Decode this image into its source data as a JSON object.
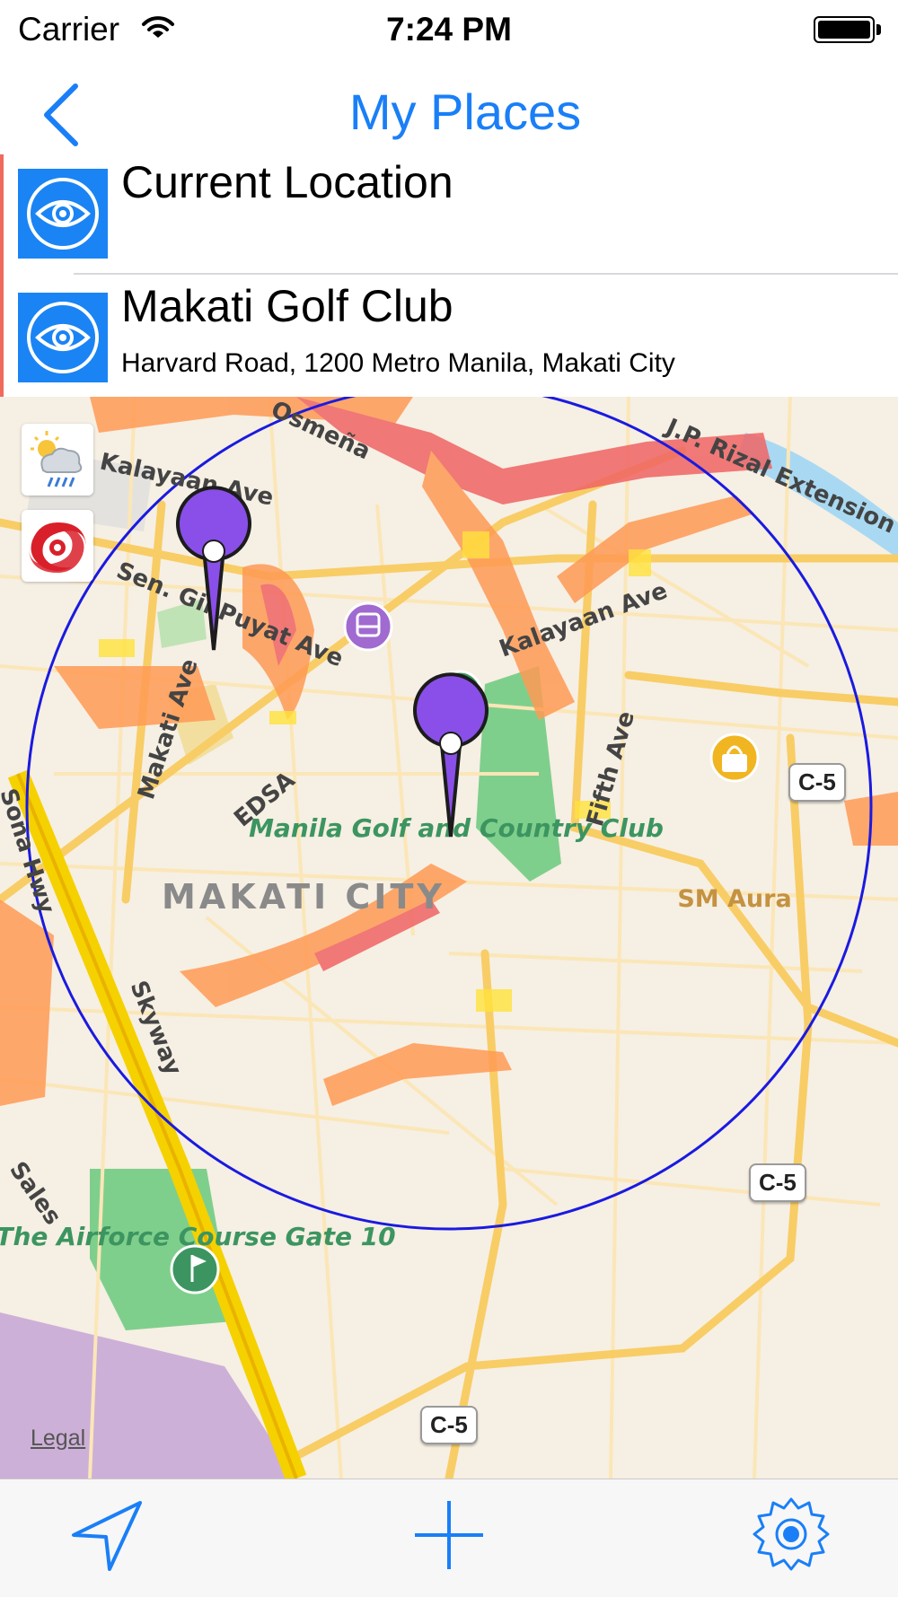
{
  "status_bar": {
    "carrier": "Carrier",
    "time": "7:24 PM"
  },
  "nav": {
    "title": "My Places",
    "back_icon": "chevron-left-icon"
  },
  "places": [
    {
      "title": "Current Location",
      "subtitle": "",
      "icon": "eye-icon"
    },
    {
      "title": "Makati Golf Club",
      "subtitle": "Harvard Road, 1200 Metro Manila, Makati City",
      "icon": "eye-icon"
    }
  ],
  "map": {
    "legal": "Legal",
    "area_label": "MAKATI CITY",
    "street_labels": [
      "Kalayaan Ave",
      "J.P. Rizal Extension",
      "Sen. Gil Puyat Ave",
      "Makati Ave",
      "EDSA",
      "Fifth Ave",
      "Skyway",
      "Osmeña",
      "Sales",
      "Sona Hwy"
    ],
    "poi_labels": {
      "golf_club": "Manila Golf and Country Club",
      "airforce": "The Airforce Course Gate 10",
      "mall": "SM Aura"
    },
    "road_shields": [
      "C-5",
      "C-5",
      "C-5"
    ],
    "overlay_icons": [
      "weather-icon",
      "typhoon-icon"
    ],
    "pins": 2
  },
  "toolbar": {
    "items": [
      "location-arrow-icon",
      "add-icon",
      "settings-gear-icon"
    ]
  },
  "colors": {
    "accent": "#1a7ff7",
    "pin": "#8a4fe8",
    "radius_circle": "#1a1ae0",
    "hazard_red": "#f06464",
    "hazard_orange": "#ff9a55",
    "hazard_yellow": "#ffe23c"
  }
}
